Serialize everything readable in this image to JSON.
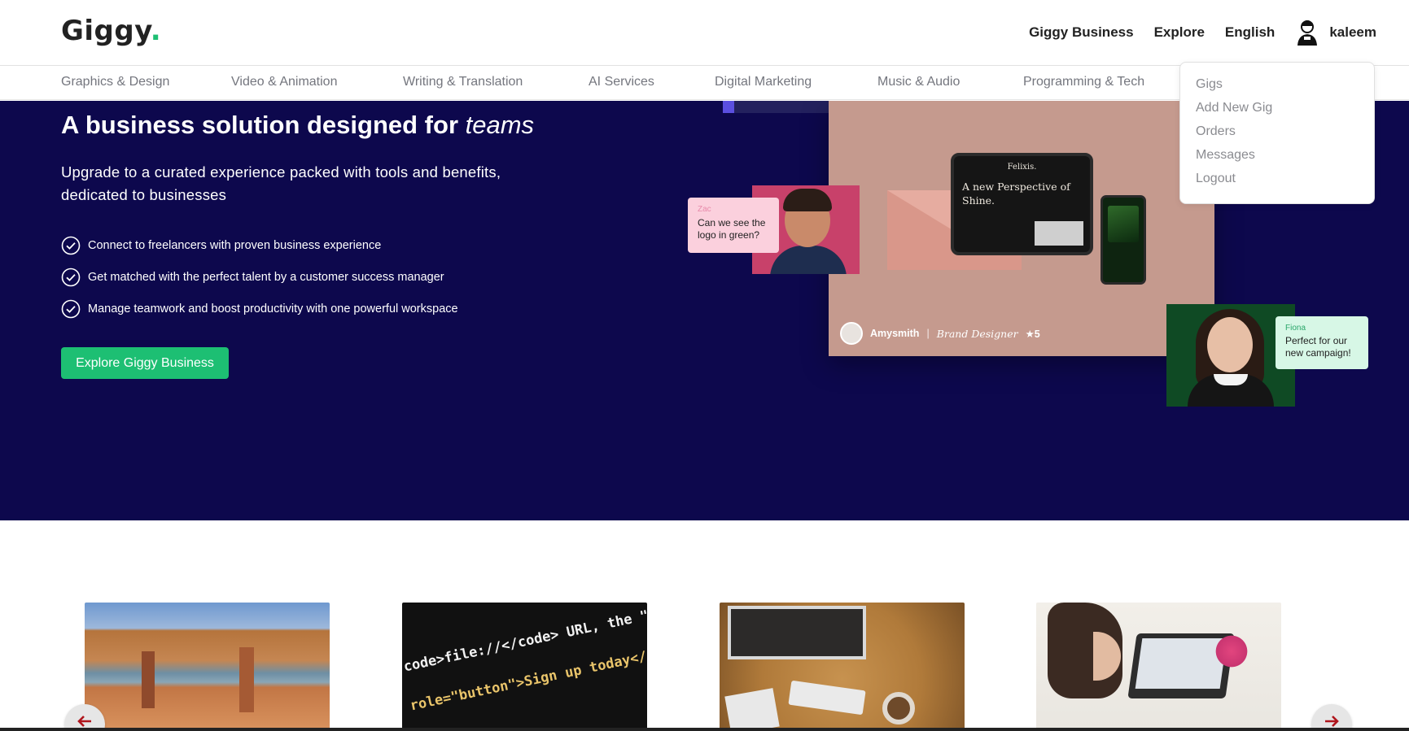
{
  "navbar": {
    "logo_text": "Giggy",
    "logo_dot": ".",
    "links": [
      "Giggy Business",
      "Explore",
      "English"
    ],
    "username": "kaleem"
  },
  "categories": [
    "Graphics & Design",
    "Video & Animation",
    "Writing & Translation",
    "AI Services",
    "Digital Marketing",
    "Music & Audio",
    "Programming & Tech"
  ],
  "user_menu": {
    "items": [
      "Gigs",
      "Add New Gig",
      "Orders",
      "Messages",
      "Logout"
    ]
  },
  "hero": {
    "title_main": "A business solution designed for ",
    "title_emphasis": "teams",
    "subtitle": "Upgrade to a curated experience packed with tools and benefits, dedicated to businesses",
    "benefits": [
      "Connect to freelancers with proven business experience",
      "Get matched with the perfect talent by a customer success manager",
      "Manage teamwork and boost productivity with one powerful workspace"
    ],
    "cta_label": "Explore Giggy Business",
    "collage": {
      "tablet_brand": "Felixis.",
      "tablet_headline": "A new Perspective of Shine.",
      "designer_name": "Amysmith",
      "designer_sep": "|",
      "designer_role": "Brand Designer",
      "designer_rating": "★5",
      "zac_name": "Zac",
      "zac_message": "Can we see the logo in green?",
      "fiona_name": "Fiona",
      "fiona_message": "Perfect for our new campaign!"
    }
  },
  "cards": {
    "code_lines": [
      "code>file://</code> URL, the \"next\"",
      "role=\"button\">Sign up today</a></p>"
    ]
  },
  "colors": {
    "brand_green": "#1dbf73",
    "hero_bg": "#0d084d",
    "arrow_red": "#b0161d"
  },
  "icons": {
    "check": "check-circle-icon",
    "prev": "arrow-left-icon",
    "next": "arrow-right-icon"
  }
}
